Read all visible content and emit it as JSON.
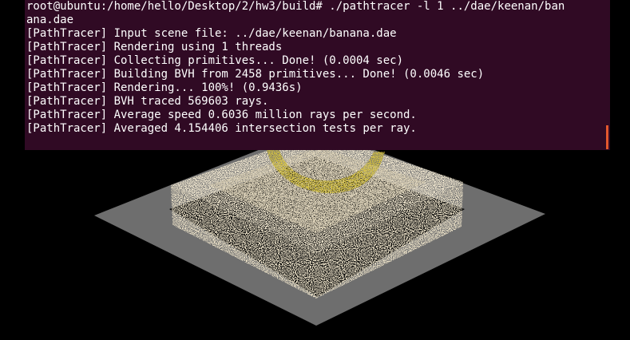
{
  "terminal": {
    "lines": [
      "root@ubuntu:/home/hello/Desktop/2/hw3/build# ./pathtracer -l 1 ../dae/keenan/ban",
      "ana.dae",
      "[PathTracer] Input scene file: ../dae/keenan/banana.dae",
      "[PathTracer] Rendering using 1 threads",
      "[PathTracer] Collecting primitives... Done! (0.0004 sec)",
      "[PathTracer] Building BVH from 2458 primitives... Done! (0.0046 sec)",
      "[PathTracer] Rendering... 100%! (0.9436s)",
      "[PathTracer] BVH traced 569603 rays.",
      "[PathTracer] Average speed 0.6036 million rays per second.",
      "[PathTracer] Averaged 4.154406 intersection tests per ray."
    ],
    "background": "#300a24",
    "text_color": "#ffffff",
    "cursor_color": "#e4572e"
  },
  "render": {
    "background": "#000000",
    "floor_color": "#6e6e6e",
    "tray_color": "#f4ead2",
    "banana_color": "#d6c23a"
  }
}
